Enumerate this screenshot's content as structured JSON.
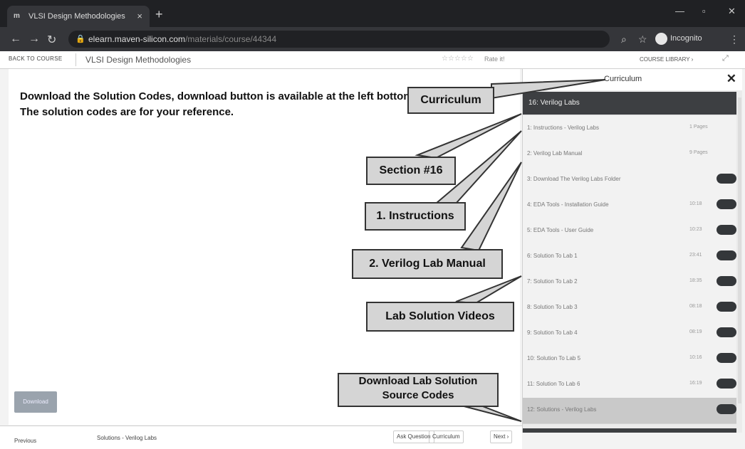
{
  "browser": {
    "tab_title": "VLSI Design Methodologies",
    "tab_favicon": "m",
    "url_domain": "elearn.maven-silicon.com",
    "url_path": "/materials/course/44344",
    "profile_label": "Incognito"
  },
  "course_header": {
    "back_label": "BACK TO COURSE",
    "course_title": "VLSI Design Methodologies",
    "rating_label": "Rate it!",
    "library_label": "COURSE LIBRARY ›"
  },
  "content": {
    "instruction_text": "Download the Solution Codes, download button is available at the left bottom. The solution codes are for your reference.",
    "download_button_label": "Download"
  },
  "sidebar": {
    "title": "Curriculum",
    "section_title": "16: Verilog Labs",
    "items": [
      {
        "label": "1: Instructions - Verilog Labs",
        "meta": "1 Pages"
      },
      {
        "label": "2: Verilog Lab Manual",
        "meta": "9 Pages"
      },
      {
        "label": "3: Download The Verilog Labs Folder",
        "meta": ""
      },
      {
        "label": "4: EDA Tools - Installation Guide",
        "meta": "10:18"
      },
      {
        "label": "5: EDA Tools - User Guide",
        "meta": "10:23"
      },
      {
        "label": "6: Solution To Lab 1",
        "meta": "23:41"
      },
      {
        "label": "7: Solution To Lab 2",
        "meta": "18:35"
      },
      {
        "label": "8: Solution To Lab 3",
        "meta": "08:18"
      },
      {
        "label": "9: Solution To Lab 4",
        "meta": "08:19"
      },
      {
        "label": "10: Solution To Lab 5",
        "meta": "10:16"
      },
      {
        "label": "11: Solution To Lab 6",
        "meta": "16:19"
      },
      {
        "label": "12: Solutions - Verilog Labs",
        "meta": ""
      }
    ]
  },
  "bottom_bar": {
    "previous_label": "Previous",
    "current_lesson": "Solutions - Verilog Labs",
    "ask_label": "Ask Question",
    "curriculum_label": "Curriculum",
    "next_label": "Next ›"
  },
  "annotations": {
    "curriculum": "Curriculum",
    "section": "Section #16",
    "instructions": "1. Instructions",
    "lab_manual": "2. Verilog Lab Manual",
    "lab_videos": "Lab Solution Videos",
    "download_line1": "Download Lab Solution",
    "download_line2": "Source Codes"
  },
  "colors": {
    "chrome_dark": "#202124",
    "section_bar": "#3d3f42",
    "callout_fill": "#d5d5d5"
  }
}
